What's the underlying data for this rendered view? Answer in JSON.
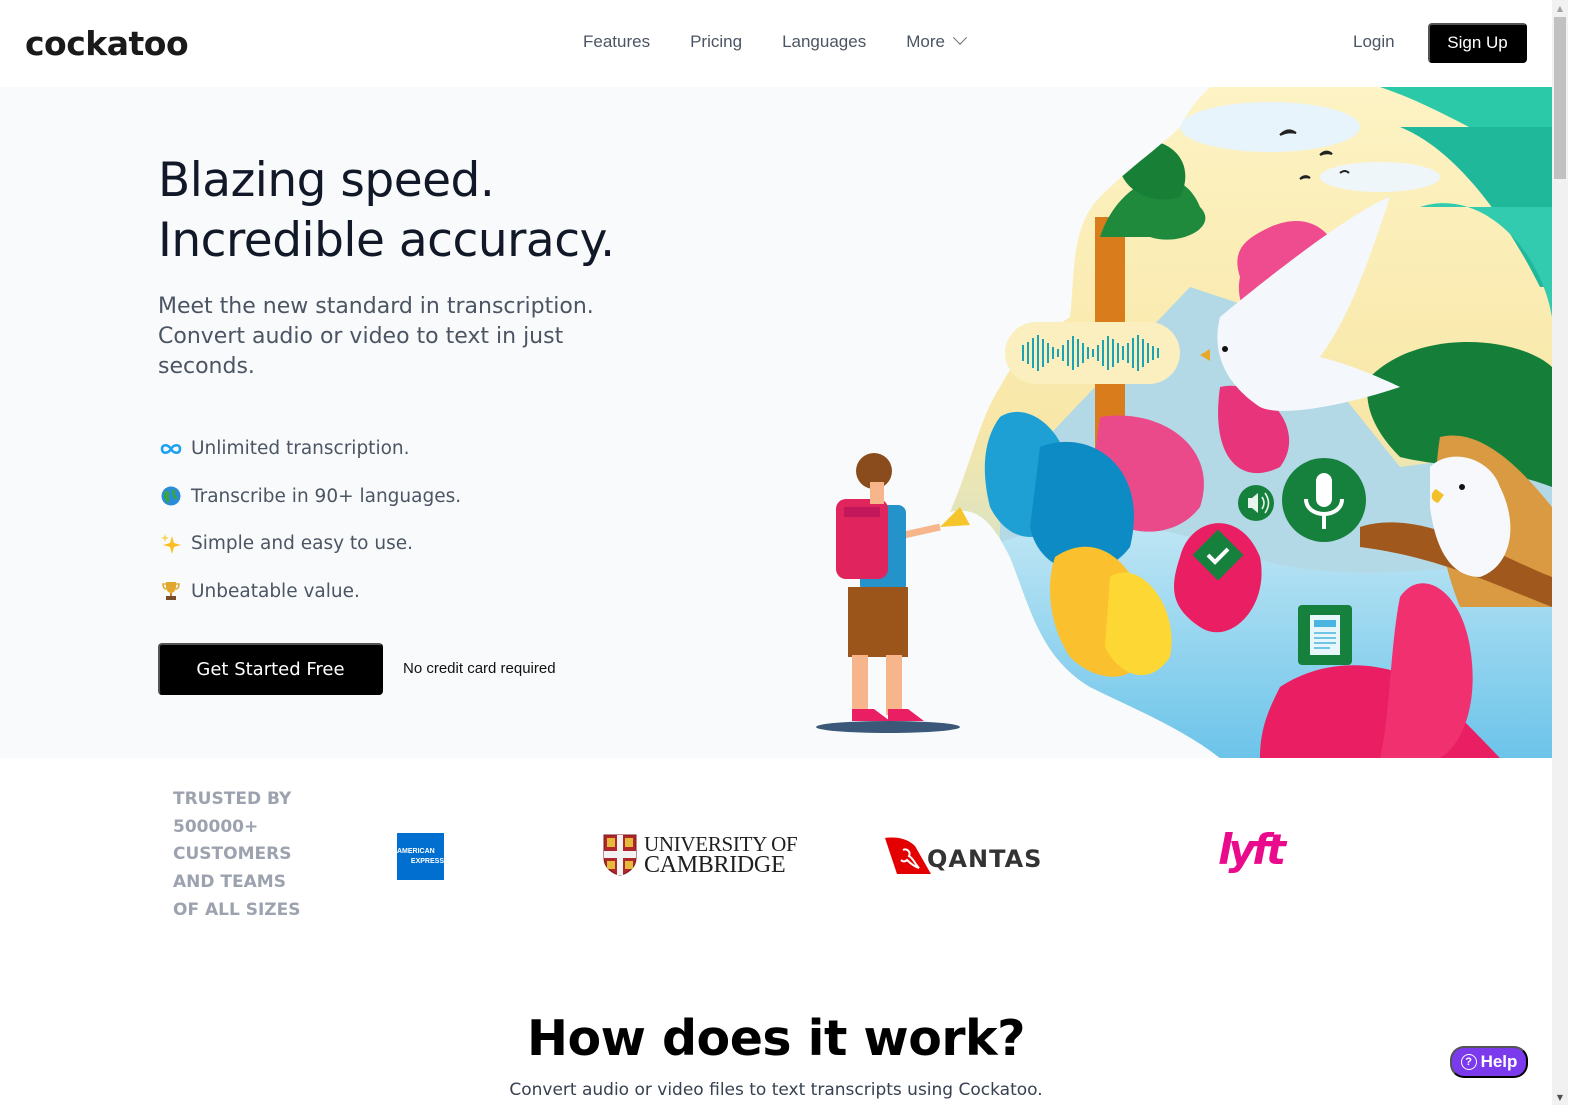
{
  "header": {
    "logo": "cockatoo",
    "nav": [
      {
        "label": "Features"
      },
      {
        "label": "Pricing"
      },
      {
        "label": "Languages"
      },
      {
        "label": "More",
        "has_dropdown": true
      }
    ],
    "login_label": "Login",
    "signup_label": "Sign Up"
  },
  "hero": {
    "title_line1": "Blazing speed.",
    "title_line2": "Incredible accuracy.",
    "subtitle": "Meet the new standard in transcription. Convert audio or video to text in just seconds.",
    "features": [
      {
        "icon": "infinity-icon",
        "glyph": "∞",
        "label": "Unlimited transcription."
      },
      {
        "icon": "globe-icon",
        "glyph": "🌍",
        "label": "Transcribe in 90+ languages."
      },
      {
        "icon": "sparkles-icon",
        "glyph": "✨",
        "label": "Simple and easy to use."
      },
      {
        "icon": "trophy-icon",
        "glyph": "🏆",
        "label": "Unbeatable value."
      }
    ],
    "cta_label": "Get Started Free",
    "cta_note": "No credit card required"
  },
  "trusted": {
    "label_lines": [
      "TRUSTED BY",
      "500000+",
      "CUSTOMERS",
      "AND TEAMS",
      "OF ALL SIZES"
    ],
    "logos": [
      {
        "name": "American Express",
        "line1": "AMERICAN",
        "line2": "EXPRESS",
        "color": "#006fcf"
      },
      {
        "name": "University of Cambridge",
        "line1": "UNIVERSITY OF",
        "line2": "CAMBRIDGE"
      },
      {
        "name": "Qantas",
        "text": "QANTAS",
        "color": "#e40000"
      },
      {
        "name": "Lyft",
        "text": "lyft",
        "color": "#ea0b8c"
      }
    ]
  },
  "how": {
    "title": "How does it work?",
    "subtitle": "Convert audio or video files to text transcripts using Cockatoo."
  },
  "help_label": "Help",
  "colors": {
    "primary_button": "#000000",
    "hero_bg": "#f9fafb",
    "help_button": "#7c3aed",
    "muted_text": "#9ca3af"
  }
}
